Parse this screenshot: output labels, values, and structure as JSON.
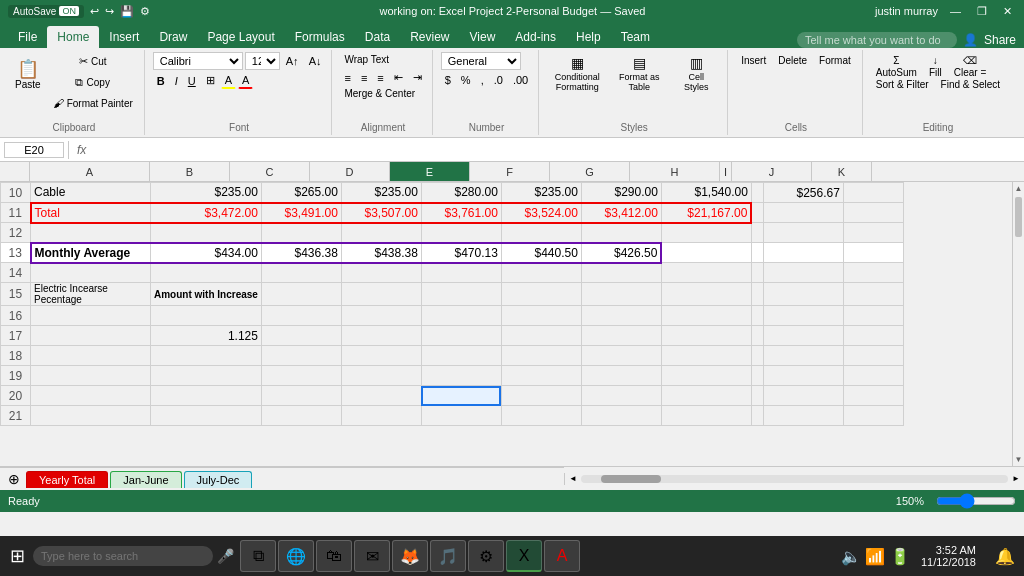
{
  "title_bar": {
    "autosave": "AutoSave",
    "autosave_on": "ON",
    "document_title": "working on: Excel Project 2-Personal Budget — Saved",
    "user": "justin murray",
    "minimize": "—",
    "restore": "❐",
    "close": "✕"
  },
  "ribbon": {
    "tabs": [
      "File",
      "Home",
      "Insert",
      "Draw",
      "Page Layout",
      "Formulas",
      "Data",
      "Review",
      "View",
      "Add-ins",
      "Help",
      "Team"
    ],
    "active_tab": "Home",
    "search_placeholder": "Tell me what you want to do",
    "share_label": "Share"
  },
  "toolbar": {
    "clipboard_label": "Clipboard",
    "font_label": "Font",
    "alignment_label": "Alignment",
    "number_label": "Number",
    "styles_label": "Styles",
    "cells_label": "Cells",
    "editing_label": "Editing",
    "paste_label": "Paste",
    "cut_label": "Cut",
    "copy_label": "Copy",
    "format_painter_label": "Format Painter",
    "font_name": "Calibri",
    "font_size": "12",
    "bold": "B",
    "italic": "I",
    "underline": "U",
    "wrap_text": "Wrap Text",
    "merge_center": "Merge & Center",
    "number_format": "General",
    "dollar": "$",
    "percent": "%",
    "comma": ",",
    "increase_decimal": ".0",
    "decrease_decimal": ".00",
    "conditional_formatting": "Conditional Formatting",
    "format_as_table": "Format as Table",
    "cell_styles": "Cell Styles",
    "insert_label": "Insert",
    "delete_label": "Delete",
    "format_label": "Format",
    "autosum": "AutoSum",
    "fill": "Fill",
    "clear": "Clear =",
    "sort_filter": "Sort & Filter",
    "find_select": "Find & Select"
  },
  "formula_bar": {
    "cell_ref": "E20",
    "fx_label": "fx",
    "formula": ""
  },
  "columns": {
    "headers": [
      "A",
      "B",
      "C",
      "D",
      "E",
      "F",
      "G",
      "H",
      "I",
      "J",
      "K"
    ]
  },
  "rows": [
    {
      "num": "10",
      "cells": [
        "Cable",
        "$235.00",
        "$265.00",
        "$235.00",
        "$280.00",
        "$235.00",
        "$290.00",
        "$1,540.00",
        "",
        "$256.67",
        ""
      ]
    },
    {
      "num": "11",
      "cells": [
        "Total",
        "$3,472.00",
        "$3,491.00",
        "$3,507.00",
        "$3,761.00",
        "$3,524.00",
        "$3,412.00",
        "$21,167.00",
        "",
        "",
        ""
      ]
    },
    {
      "num": "12",
      "cells": [
        "",
        "",
        "",
        "",
        "",
        "",
        "",
        "",
        "",
        "",
        ""
      ]
    },
    {
      "num": "13",
      "cells": [
        "Monthly Average",
        "$434.00",
        "$436.38",
        "$438.38",
        "$470.13",
        "$440.50",
        "$426.50",
        "",
        "",
        "",
        ""
      ]
    },
    {
      "num": "14",
      "cells": [
        "",
        "",
        "",
        "",
        "",
        "",
        "",
        "",
        "",
        "",
        ""
      ]
    },
    {
      "num": "15",
      "cells": [
        "Electric Incearse Pecentage",
        "Amount with Increase",
        "",
        "",
        "",
        "",
        "",
        "",
        "",
        "",
        ""
      ]
    },
    {
      "num": "16",
      "cells": [
        "",
        "",
        "",
        "",
        "",
        "",
        "",
        "",
        "",
        "",
        ""
      ]
    },
    {
      "num": "17",
      "cells": [
        "",
        "1.125",
        "",
        "",
        "",
        "",
        "",
        "",
        "",
        "",
        ""
      ]
    },
    {
      "num": "18",
      "cells": [
        "",
        "",
        "",
        "",
        "",
        "",
        "",
        "",
        "",
        "",
        ""
      ]
    },
    {
      "num": "19",
      "cells": [
        "",
        "",
        "",
        "",
        "",
        "",
        "",
        "",
        "",
        "",
        ""
      ]
    },
    {
      "num": "20",
      "cells": [
        "",
        "",
        "",
        "",
        "",
        "",
        "",
        "",
        "",
        "",
        ""
      ]
    },
    {
      "num": "21",
      "cells": [
        "",
        "",
        "",
        "",
        "",
        "",
        "",
        "",
        "",
        "",
        ""
      ]
    }
  ],
  "sheet_tabs": [
    {
      "label": "Yearly Total",
      "type": "yearly"
    },
    {
      "label": "Jan-June",
      "type": "jan-june"
    },
    {
      "label": "July-Dec",
      "type": "july-dec"
    }
  ],
  "status_bar": {
    "ready": "Ready",
    "zoom": "150%"
  },
  "taskbar": {
    "search_placeholder": "Type here to search",
    "time": "3:52 AM",
    "date": "11/12/2018",
    "apps": [
      "⊞",
      "🔍",
      "📋",
      "📁",
      "🌐",
      "✉",
      "🎵",
      "🔵",
      "📷",
      "🅆",
      "🅇",
      "🎮",
      "🔧"
    ]
  }
}
